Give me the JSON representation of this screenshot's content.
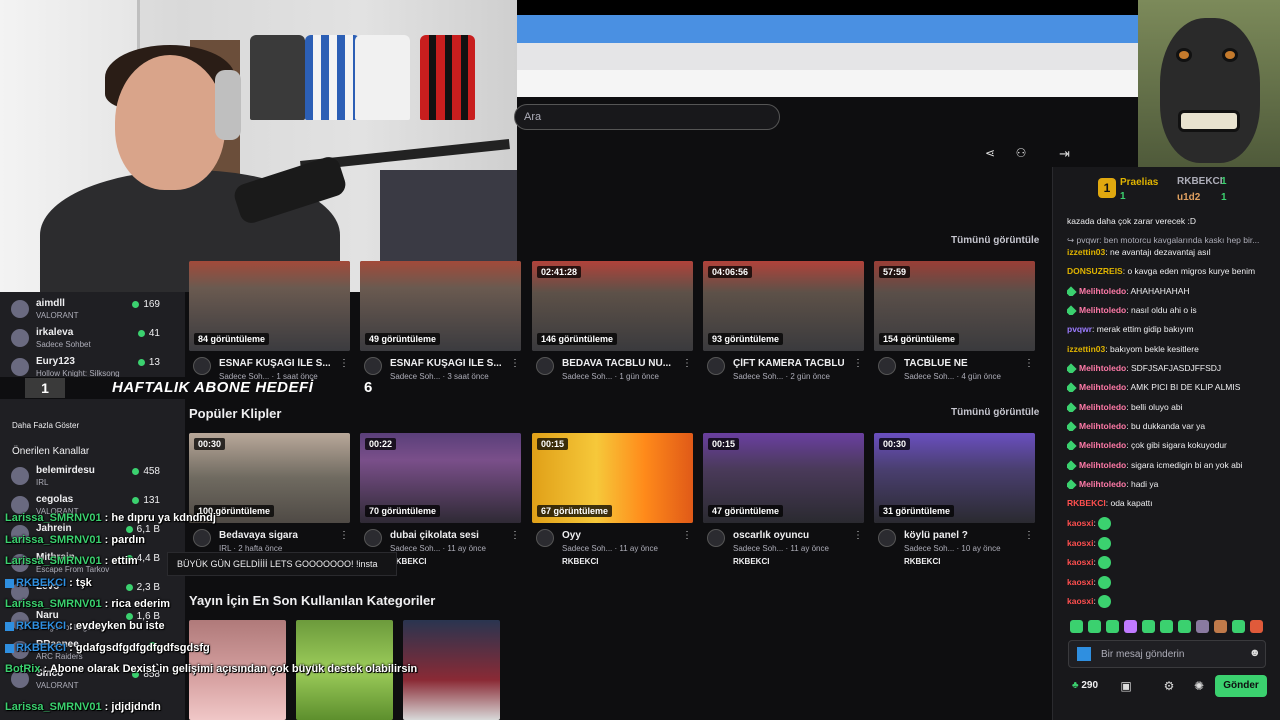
{
  "search": {
    "placeholder": "Ara"
  },
  "leaderboard": {
    "first": {
      "rank": "1",
      "name": "Praelias",
      "count": "1"
    },
    "second": {
      "name": "RKBEKCI",
      "count": "1"
    },
    "third": {
      "name": "u1d2",
      "count": "1"
    }
  },
  "sidebar": {
    "channels": [
      {
        "name": "aimdll",
        "category": "VALORANT",
        "viewers": "169"
      },
      {
        "name": "irkaleva",
        "category": "Sadece Sohbet",
        "viewers": "41"
      },
      {
        "name": "Eury123",
        "category": "Hollow Knight: Silksong",
        "viewers": "13"
      }
    ],
    "show_more": "Daha Fazla Göster",
    "recommended_title": "Önerilen Kanallar",
    "recommended": [
      {
        "name": "belemirdesu",
        "category": "IRL",
        "viewers": "458"
      },
      {
        "name": "cegolas",
        "category": "VALORANT",
        "viewers": "131"
      },
      {
        "name": "Jahrein",
        "category": "",
        "viewers": "6,1 B"
      },
      {
        "name": "Mithrain",
        "category": "Escape From Tarkov",
        "viewers": "4,4 B"
      },
      {
        "name": "Levo",
        "category": "",
        "viewers": "2,3 B"
      },
      {
        "name": "Naru",
        "category": "League of Legends",
        "viewers": "1,6 B"
      },
      {
        "name": "RRaenee",
        "category": "ARC Raiders",
        "viewers": ""
      },
      {
        "name": "Sinco",
        "category": "VALORANT",
        "viewers": "858"
      }
    ]
  },
  "goal": {
    "current": "1",
    "label": "HAFTALIK ABONE HEDEFİ",
    "target": "6"
  },
  "videos": {
    "see_all": "Tümünü görüntüle",
    "items": [
      {
        "duration": "",
        "views": "84 görüntüleme",
        "title": "ESNAF KUŞAĞI İLE S...",
        "channel": "Sadece Soh...",
        "ago": "1 saat önce"
      },
      {
        "duration": "",
        "views": "49 görüntüleme",
        "title": "ESNAF KUŞAĞI İLE S...",
        "channel": "Sadece Soh...",
        "ago": "3 saat önce"
      },
      {
        "duration": "02:41:28",
        "views": "146 görüntüleme",
        "title": "BEDAVA TACBLU NU...",
        "channel": "Sadece Soh...",
        "ago": "1 gün önce"
      },
      {
        "duration": "04:06:56",
        "views": "93 görüntüleme",
        "title": "ÇİFT KAMERA TACBLU",
        "channel": "Sadece Soh...",
        "ago": "2 gün önce"
      },
      {
        "duration": "57:59",
        "views": "154 görüntüleme",
        "title": "TACBLUE NE",
        "channel": "Sadece Soh...",
        "ago": "4 gün önce"
      }
    ]
  },
  "clips": {
    "title": "Popüler Klipler",
    "see_all": "Tümünü görüntüle",
    "items": [
      {
        "duration": "00:30",
        "views": "100 görüntüleme",
        "title": "Bedavaya sigara",
        "channel": "IRL",
        "ago": "2 hafta önce",
        "by": ""
      },
      {
        "duration": "00:22",
        "views": "70 görüntüleme",
        "title": "dubai çikolata sesi",
        "channel": "Sadece Soh...",
        "ago": "11 ay önce",
        "by": "RKBEKCI"
      },
      {
        "duration": "00:15",
        "views": "67 görüntüleme",
        "title": "Oyy",
        "channel": "Sadece Soh...",
        "ago": "11 ay önce",
        "by": "RKBEKCI"
      },
      {
        "duration": "00:15",
        "views": "47 görüntüleme",
        "title": "oscarlık oyuncu",
        "channel": "Sadece Soh...",
        "ago": "11 ay önce",
        "by": "RKBEKCI"
      },
      {
        "duration": "00:30",
        "views": "31 görüntüleme",
        "title": "köylü panel ?",
        "channel": "Sadece Soh...",
        "ago": "10 ay önce",
        "by": "RKBEKCI"
      }
    ]
  },
  "categories": {
    "title": "Yayın İçin En Son Kullanılan Kategoriler"
  },
  "chat": {
    "messages": [
      {
        "user": "",
        "text": "kazada daha çok zarar verecek :D",
        "color": "#efeff1"
      },
      {
        "user": "",
        "text": "↪ pvqwr: ben motorcu kavgalarında kaskı hep bir...",
        "color": "#adadb8"
      },
      {
        "user": "izzettin03",
        "text": "ne avantajı dezavantaj asıl",
        "color": "#e0b400"
      },
      {
        "user": "DONSUZREIS",
        "text": "o kavga eden migros kurye benim",
        "color": "#e0b400"
      },
      {
        "user": "Melihtoledo",
        "text": "AHAHAHAHAH",
        "color": "#ff7aa8"
      },
      {
        "user": "Melihtoledo",
        "text": "nasıl oldu ahi o is",
        "color": "#ff7aa8"
      },
      {
        "user": "pvqwr",
        "text": "merak ettim gidip bakıyım",
        "color": "#9b7bff"
      },
      {
        "user": "izzettin03",
        "text": "bakıyom bekle kesitlere",
        "color": "#e0b400"
      },
      {
        "user": "Melihtoledo",
        "text": "SDFJSAFJASDJFFSDJ",
        "color": "#ff7aa8"
      },
      {
        "user": "Melihtoledo",
        "text": "AMK PICI BI DE KLIP ALMIS",
        "color": "#ff7aa8"
      },
      {
        "user": "Melihtoledo",
        "text": "belli oluyo abi",
        "color": "#ff7aa8"
      },
      {
        "user": "Melihtoledo",
        "text": "bu dukkanda var ya",
        "color": "#ff7aa8"
      },
      {
        "user": "Melihtoledo",
        "text": "çok gibi sigara kokuyodur",
        "color": "#ff7aa8"
      },
      {
        "user": "Melihtoledo",
        "text": "sigara icmedigin bi an yok abi",
        "color": "#ff7aa8"
      },
      {
        "user": "Melihtoledo",
        "text": "hadi ya",
        "color": "#ff7aa8"
      },
      {
        "user": "RKBEKCI",
        "text": "oda kapattı",
        "color": "#ff4f4f"
      },
      {
        "user": "kaosxi",
        "text": "",
        "color": "#ff4f4f"
      },
      {
        "user": "kaosxi",
        "text": "",
        "color": "#ff4f4f"
      },
      {
        "user": "kaosxi",
        "text": "",
        "color": "#ff4f4f"
      },
      {
        "user": "kaosxi",
        "text": "",
        "color": "#ff4f4f"
      },
      {
        "user": "kaosxi",
        "text": "",
        "color": "#ff4f4f"
      }
    ],
    "input_placeholder": "Bir mesaj gönderin",
    "points": "290",
    "send_label": "Gönder"
  },
  "overlay_chat": [
    {
      "user": "Larissa_SMRNV01",
      "text": "he dıpru ya kdndndj"
    },
    {
      "user": "Larissa_SMRNV01",
      "text": "pardın"
    },
    {
      "user": "Larissa_SMRNV01",
      "text": "ettim"
    },
    {
      "user": "RKBEKCI",
      "text": "tşk"
    },
    {
      "user": "Larissa_SMRNV01",
      "text": "rica ederim"
    },
    {
      "user": "RKBEKCI",
      "text": "evdeyken bu iste"
    },
    {
      "user": "RKBEKCI",
      "text": "gdafgsdfgdfgdfgdfsgdsfg"
    },
    {
      "user": "BotRix",
      "text": "Abone olarak Dexist`in gelişimi açısından çok büyük destek olabilirsin"
    },
    {
      "user": "Larissa_SMRNV01",
      "text": "jdjdjdndn"
    }
  ],
  "banner": "BÜYÜK GÜN GELDİİİİ LETS GOOOOOOO! !insta"
}
